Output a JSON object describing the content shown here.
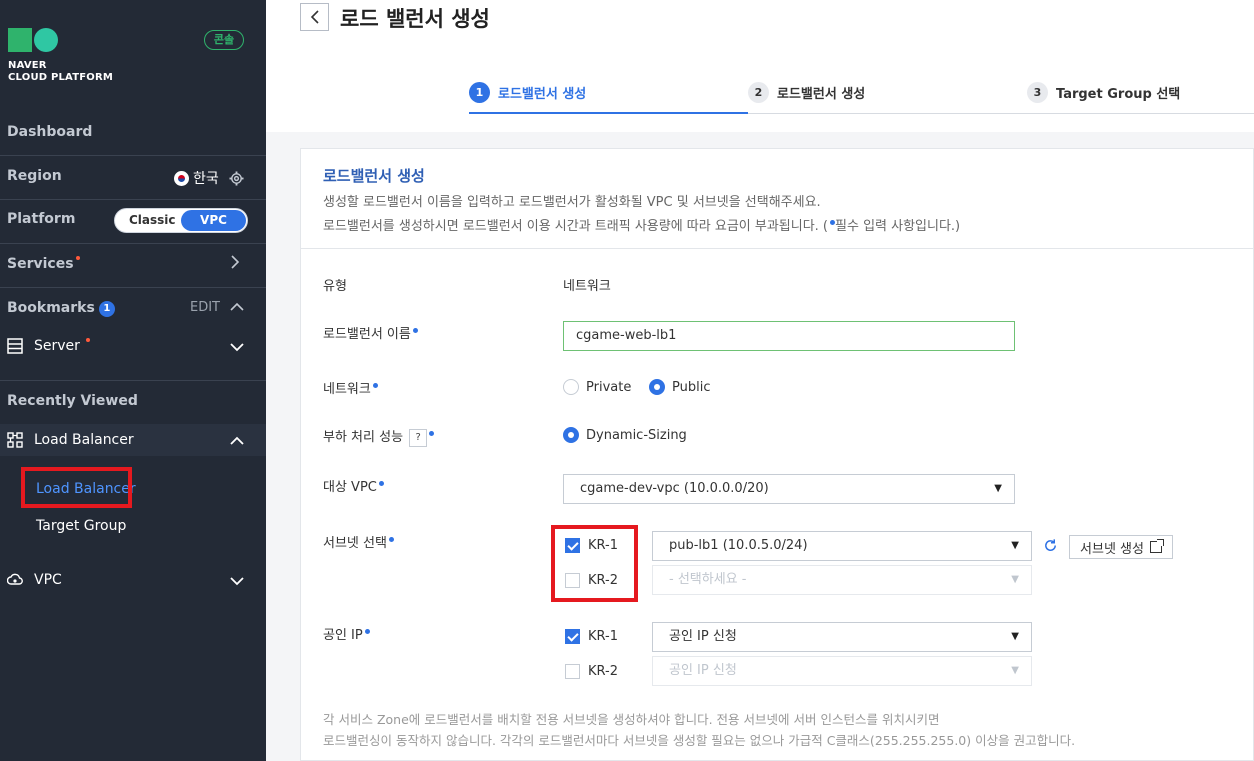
{
  "sidebar": {
    "logo_line1": "NAVER",
    "logo_line2": "CLOUD PLATFORM",
    "console_badge": "콘솔",
    "dashboard": "Dashboard",
    "region_label": "Region",
    "region_value": "한국",
    "platform_label": "Platform",
    "platform_classic": "Classic",
    "platform_vpc": "VPC",
    "services": "Services",
    "bookmarks": "Bookmarks",
    "bookmarks_count": "1",
    "edit": "EDIT",
    "server": "Server",
    "recently_viewed": "Recently Viewed",
    "load_balancer_group": "Load Balancer",
    "sub_load_balancer": "Load Balancer",
    "sub_target_group": "Target Group",
    "vpc": "VPC"
  },
  "header": {
    "back": "<",
    "title": "로드 밸런서 생성"
  },
  "steps": [
    {
      "num": "1",
      "label": "로드밸런서 생성",
      "active": true
    },
    {
      "num": "2",
      "label": "로드밸런서 생성",
      "active": false
    },
    {
      "num": "3",
      "label": "Target Group 선택",
      "active": false
    }
  ],
  "panel": {
    "title": "로드밸런서 생성",
    "desc1": "생성할 로드밸런서 이름을 입력하고 로드밸런서가 활성화될 VPC 및 서브넷을 선택해주세요.",
    "desc2_a": "로드밸런서를 생성하시면 로드밸런서 이용 시간과 트래픽 사용량에 따라 요금이 부과됩니다. (",
    "desc2_b": "필수 입력 사항입니다.)"
  },
  "form": {
    "type_label": "유형",
    "type_value": "네트워크",
    "name_label": "로드밸런서 이름",
    "name_value": "cgame-web-lb1",
    "network_label": "네트워크",
    "network_private": "Private",
    "network_public": "Public",
    "perf_label": "부하 처리 성능",
    "perf_help": "?",
    "perf_value": "Dynamic-Sizing",
    "vpc_label": "대상 VPC",
    "vpc_value": "cgame-dev-vpc (10.0.0.0/20)",
    "subnet_label": "서브넷 선택",
    "subnet_kr1": "KR-1",
    "subnet_kr1_value": "pub-lb1 (10.0.5.0/24)",
    "subnet_kr2": "KR-2",
    "subnet_kr2_placeholder": "- 선택하세요 -",
    "subnet_create_btn": "서브넷 생성",
    "ip_label": "공인 IP",
    "ip_kr1": "KR-1",
    "ip_kr1_value": "공인 IP 신청",
    "ip_kr2": "KR-2",
    "ip_kr2_value": "공인 IP 신청"
  },
  "notes": {
    "line1": "각 서비스 Zone에 로드밸런서를 배치할 전용 서브넷을 생성하셔야 합니다. 전용 서브넷에 서버 인스턴스를 위치시키면",
    "line2": "로드밸런싱이 동작하지 않습니다. 각각의 로드밸런서마다 서브넷을 생성할 필요는 없으나 가급적 C클래스(255.255.255.0) 이상을 권고합니다."
  },
  "colors": {
    "accent": "#2f72e4",
    "sidebar_bg": "#232a36",
    "highlight_box": "#e5191f",
    "input_valid_border": "#6ec174"
  }
}
